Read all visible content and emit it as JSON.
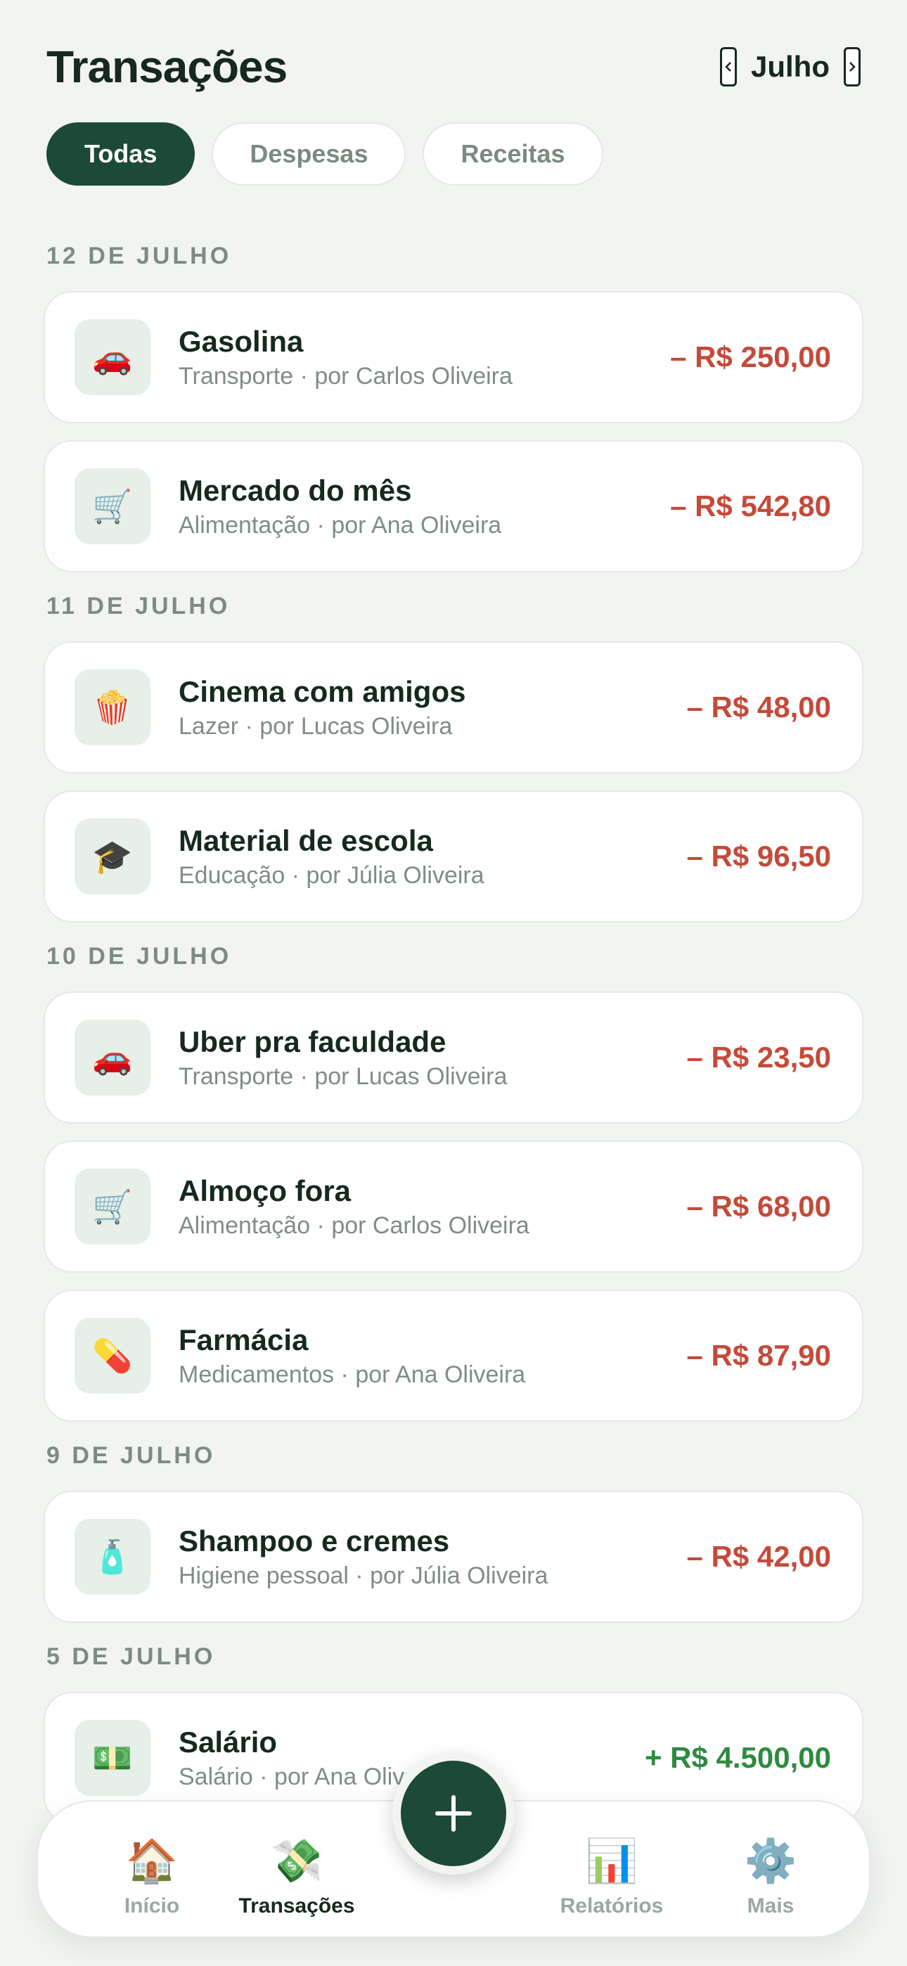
{
  "header": {
    "title": "Transações",
    "month": "Julho"
  },
  "filters": [
    {
      "label": "Todas",
      "active": true
    },
    {
      "label": "Despesas",
      "active": false
    },
    {
      "label": "Receitas",
      "active": false
    }
  ],
  "groups": [
    {
      "date": "12 DE JULHO",
      "items": [
        {
          "icon": "car-icon",
          "emoji": "🚗",
          "title": "Gasolina",
          "subtitle": "Transporte · por Carlos Oliveira",
          "amount": "– R$ 250,00",
          "type": "expense"
        },
        {
          "icon": "cart-icon",
          "emoji": "🛒",
          "title": "Mercado do mês",
          "subtitle": "Alimentação · por Ana Oliveira",
          "amount": "– R$ 542,80",
          "type": "expense"
        }
      ]
    },
    {
      "date": "11 DE JULHO",
      "items": [
        {
          "icon": "popcorn-icon",
          "emoji": "🍿",
          "title": "Cinema com amigos",
          "subtitle": "Lazer · por Lucas Oliveira",
          "amount": "– R$ 48,00",
          "type": "expense"
        },
        {
          "icon": "graduation-cap-icon",
          "emoji": "🎓",
          "title": "Material de escola",
          "subtitle": "Educação · por Júlia Oliveira",
          "amount": "– R$ 96,50",
          "type": "expense"
        }
      ]
    },
    {
      "date": "10 DE JULHO",
      "items": [
        {
          "icon": "car-icon",
          "emoji": "🚗",
          "title": "Uber pra faculdade",
          "subtitle": "Transporte · por Lucas Oliveira",
          "amount": "– R$ 23,50",
          "type": "expense"
        },
        {
          "icon": "cart-icon",
          "emoji": "🛒",
          "title": "Almoço fora",
          "subtitle": "Alimentação · por Carlos Oliveira",
          "amount": "– R$ 68,00",
          "type": "expense"
        },
        {
          "icon": "pill-icon",
          "emoji": "💊",
          "title": "Farmácia",
          "subtitle": "Medicamentos · por Ana Oliveira",
          "amount": "– R$ 87,90",
          "type": "expense"
        }
      ]
    },
    {
      "date": "9 DE JULHO",
      "items": [
        {
          "icon": "lotion-bottle-icon",
          "emoji": "🧴",
          "title": "Shampoo e cremes",
          "subtitle": "Higiene pessoal · por Júlia Oliveira",
          "amount": "– R$ 42,00",
          "type": "expense"
        }
      ]
    },
    {
      "date": "5 DE JULHO",
      "items": [
        {
          "icon": "money-icon",
          "emoji": "💵",
          "title": "Salário",
          "subtitle": "Salário · por Ana Oliveira",
          "amount": "+ R$ 4.500,00",
          "type": "income"
        }
      ]
    }
  ],
  "nav": [
    {
      "label": "Início",
      "icon": "house-icon",
      "emoji": "🏠",
      "active": false
    },
    {
      "label": "Transações",
      "icon": "money-wings-icon",
      "emoji": "💸",
      "active": true
    },
    {
      "label": "Relatórios",
      "icon": "bar-chart-icon",
      "emoji": "📊",
      "active": false
    },
    {
      "label": "Mais",
      "icon": "gear-icon",
      "emoji": "⚙️",
      "active": false
    }
  ],
  "fab": {
    "icon": "plus-icon"
  },
  "colors": {
    "primary": "#1c4a36",
    "expense": "#c44a3a",
    "income": "#2e8b3e",
    "background": "#f2f4f2"
  }
}
